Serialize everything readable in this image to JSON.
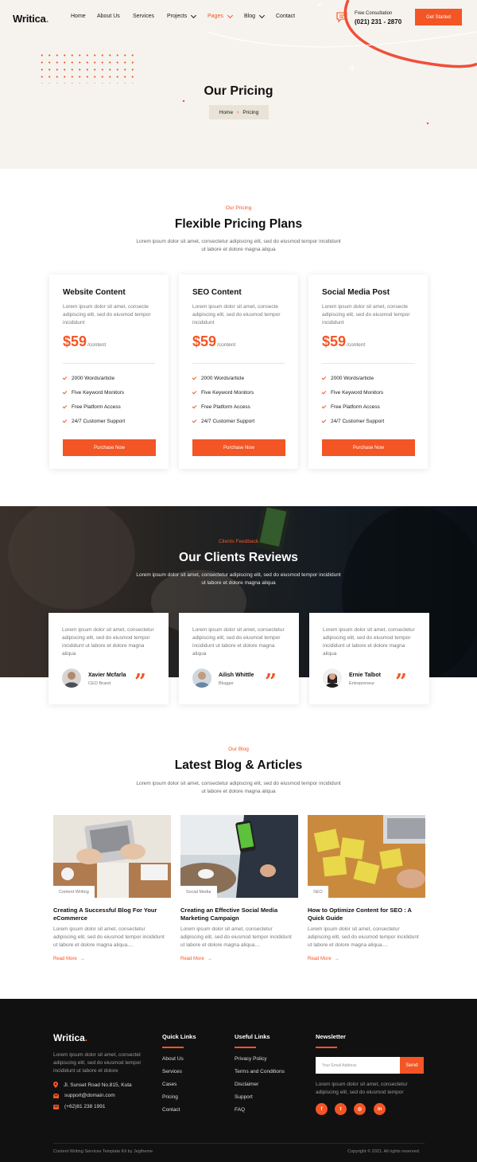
{
  "brand": {
    "name": "Writica",
    "accent": "#f35525"
  },
  "nav": {
    "items": [
      {
        "label": "Home"
      },
      {
        "label": "About Us"
      },
      {
        "label": "Services"
      },
      {
        "label": "Projects"
      },
      {
        "label": "Pages"
      },
      {
        "label": "Blog"
      },
      {
        "label": "Contact"
      }
    ],
    "consult_label": "Free Consultation",
    "consult_phone": "(021) 231 - 2870",
    "cta": "Get Started"
  },
  "hero": {
    "title": "Our Pricing",
    "breadcrumb": [
      "Home",
      "Pricing"
    ]
  },
  "pricing": {
    "eyebrow": "Our Pricing",
    "title": "Flexible Pricing Plans",
    "subtitle": "Lorem ipsum dolor sit amet, consectetur adipiscing elit, sed do eiusmod tempor incididunt ut labore et dolore magna aliqua",
    "plans": [
      {
        "title": "Website Content",
        "desc": "Lorem ipsum dolor sit amet, consecte adipiscing elit, sed do eiusmod tempor incididunt",
        "price": "$59",
        "unit": "/content",
        "features": [
          "2000 Words/article",
          "Five Keyword Monitors",
          "Free Platform Access",
          "24/7 Customer Support"
        ],
        "button": "Purchase Now"
      },
      {
        "title": "SEO Content",
        "desc": "Lorem ipsum dolor sit amet, consecte adipiscing elit, sed do eiusmod tempor incididunt",
        "price": "$59",
        "unit": "/content",
        "features": [
          "2000 Words/article",
          "Five Keyword Monitors",
          "Free Platform Access",
          "24/7 Customer Support"
        ],
        "button": "Purchase Now"
      },
      {
        "title": "Social Media Post",
        "desc": "Lorem ipsum dolor sit amet, consecte adipiscing elit, sed do eiusmod tempor incididunt",
        "price": "$59",
        "unit": "/content",
        "features": [
          "2000 Words/article",
          "Five Keyword Monitors",
          "Free Platform Access",
          "24/7 Customer Support"
        ],
        "button": "Purchase Now"
      }
    ]
  },
  "reviews": {
    "eyebrow": "Clients Feedback",
    "title": "Our Clients Reviews",
    "subtitle": "Lorem ipsum dolor sit amet, consectetur adipiscing elit, sed do eiusmod tempor incididunt ut labore et dolore magna aliqua",
    "items": [
      {
        "text": "Lorem ipsum dolor sit amet, consectetur adipiscing elit, sed do eiusmod tempor incididunt ut labore et dolore magna aliqua",
        "name": "Xavier Mcfarla",
        "role": "CEO Brand"
      },
      {
        "text": "Lorem ipsum dolor sit amet, consectetur adipiscing elit, sed do eiusmod tempor incididunt ut labore et dolore magna aliqua",
        "name": "Ailish Whittle",
        "role": "Blogger"
      },
      {
        "text": "Lorem ipsum dolor sit amet, consectetur adipiscing elit, sed do eiusmod tempor incididunt ut labore et dolore magna aliqua",
        "name": "Ernie Talbot",
        "role": "Entrepreneur"
      }
    ]
  },
  "blog": {
    "eyebrow": "Our Blog",
    "title": "Latest Blog & Articles",
    "subtitle": "Lorem ipsum dolor sit amet, consectetur adipiscing elit, sed do eiusmod tempor incididunt ut labore et dolore magna aliqua",
    "posts": [
      {
        "tag": "Content Writing",
        "title": "Creating A Successful Blog For Your eCommerce",
        "excerpt": "Lorem ipsum dolor sit amet, consectetur adipiscing elit, sed do eiusmod tempor incididunt ut labore et dolore magna aliqua....",
        "read_more": "Read More"
      },
      {
        "tag": "Social Media",
        "title": "Creating an Effective Social Media Marketing Campaign",
        "excerpt": "Lorem ipsum dolor sit amet, consectetur adipiscing elit, sed do eiusmod tempor incididunt ut labore et dolore magna aliqua....",
        "read_more": "Read More"
      },
      {
        "tag": "SEO",
        "title": "How to Optimize Content for SEO : A Quick Guide",
        "excerpt": "Lorem ipsum dolor sit amet, consectetur adipiscing elit, sed do eiusmod tempor incididunt ut labore et dolore magna aliqua....",
        "read_more": "Read More"
      }
    ]
  },
  "footer": {
    "logo": "Writica",
    "desc": "Lorem ipsum dolor sit amet, consectet adipiscing elit, sed do eiusmod tempor incididunt ut labore et dolore",
    "address": "Jl. Sunset Road No.815, Kuta",
    "email": "support@domain.com",
    "phone": "(+62)81 238 1991",
    "quick_links_title": "Quick Links",
    "quick_links": [
      "About Us",
      "Services",
      "Cases",
      "Pricing",
      "Contact"
    ],
    "useful_links_title": "Useful Links",
    "useful_links": [
      "Privacy Policy",
      "Terms and Conditions",
      "Disclaimer",
      "Support",
      "FAQ"
    ],
    "newsletter_title": "Newsletter",
    "newsletter_placeholder": "Your Email Address",
    "newsletter_button": "Send",
    "newsletter_text": "Lorem ipsum dolor sit amet, consectetur adipiscing elit, sed do eiusmod tempor",
    "social": [
      {
        "icon": "facebook-icon",
        "glyph": "f"
      },
      {
        "icon": "twitter-icon",
        "glyph": "t"
      },
      {
        "icon": "instagram-icon",
        "glyph": "◎"
      },
      {
        "icon": "linkedin-icon",
        "glyph": "in"
      }
    ],
    "credit": "Content Writing Services Template Kit by Jegtheme",
    "copyright": "Copyright © 2021. All rights reserved."
  }
}
